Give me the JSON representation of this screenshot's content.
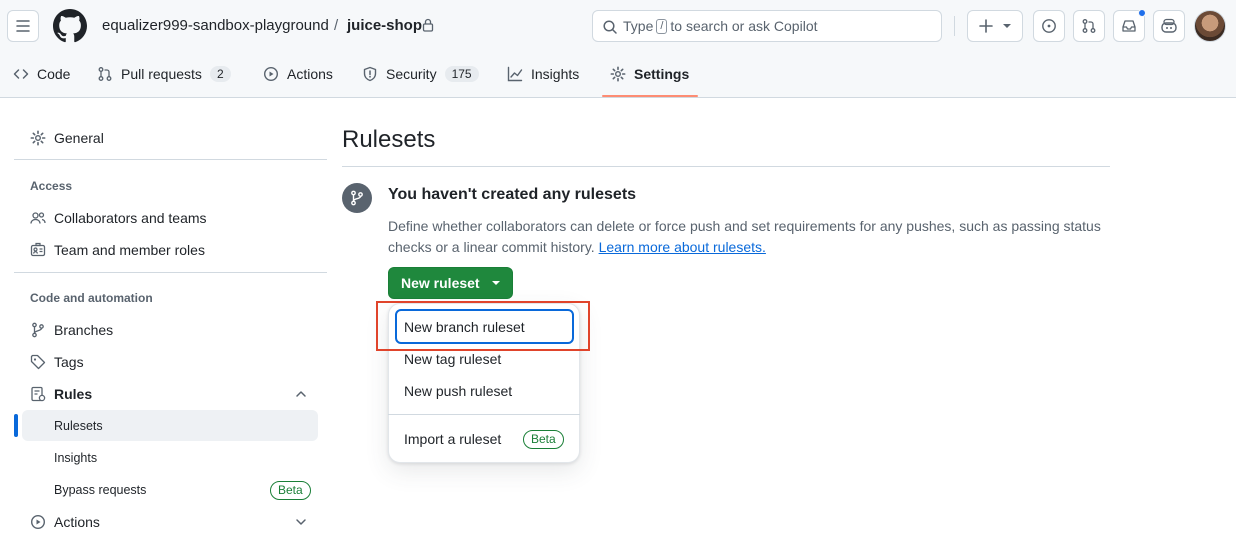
{
  "header": {
    "owner": "equalizer999-sandbox-playground",
    "separator": "/",
    "repo": "juice-shop",
    "search_prefix": "Type",
    "search_key": "/",
    "search_suffix": "to search or ask Copilot"
  },
  "tabs": [
    {
      "label": "Code",
      "icon": "code-icon"
    },
    {
      "label": "Pull requests",
      "icon": "pull-request-icon",
      "count": "2"
    },
    {
      "label": "Actions",
      "icon": "play-icon"
    },
    {
      "label": "Security",
      "icon": "shield-icon",
      "count": "175"
    },
    {
      "label": "Insights",
      "icon": "graph-icon"
    },
    {
      "label": "Settings",
      "icon": "gear-icon",
      "active": true
    }
  ],
  "sidebar": {
    "general": "General",
    "access_heading": "Access",
    "collaborators": "Collaborators and teams",
    "member_roles": "Team and member roles",
    "code_heading": "Code and automation",
    "branches": "Branches",
    "tags": "Tags",
    "rules": "Rules",
    "rulesets": "Rulesets",
    "insights": "Insights",
    "bypass": "Bypass requests",
    "bypass_badge": "Beta",
    "actions": "Actions"
  },
  "main": {
    "title": "Rulesets",
    "blank_title": "You haven't created any rulesets",
    "blank_desc": "Define whether collaborators can delete or force push and set requirements for any pushes, such as passing status checks or a linear commit history.",
    "learn_more": "Learn more about rulesets.",
    "new_button": "New ruleset"
  },
  "menu": {
    "items": [
      "New branch ruleset",
      "New tag ruleset",
      "New push ruleset"
    ],
    "import": "Import a ruleset",
    "import_badge": "Beta"
  },
  "colors": {
    "primary_button": "#1f883d",
    "accent": "#0969da",
    "tab_underline": "#fd8c73",
    "highlight": "#e0442b"
  }
}
